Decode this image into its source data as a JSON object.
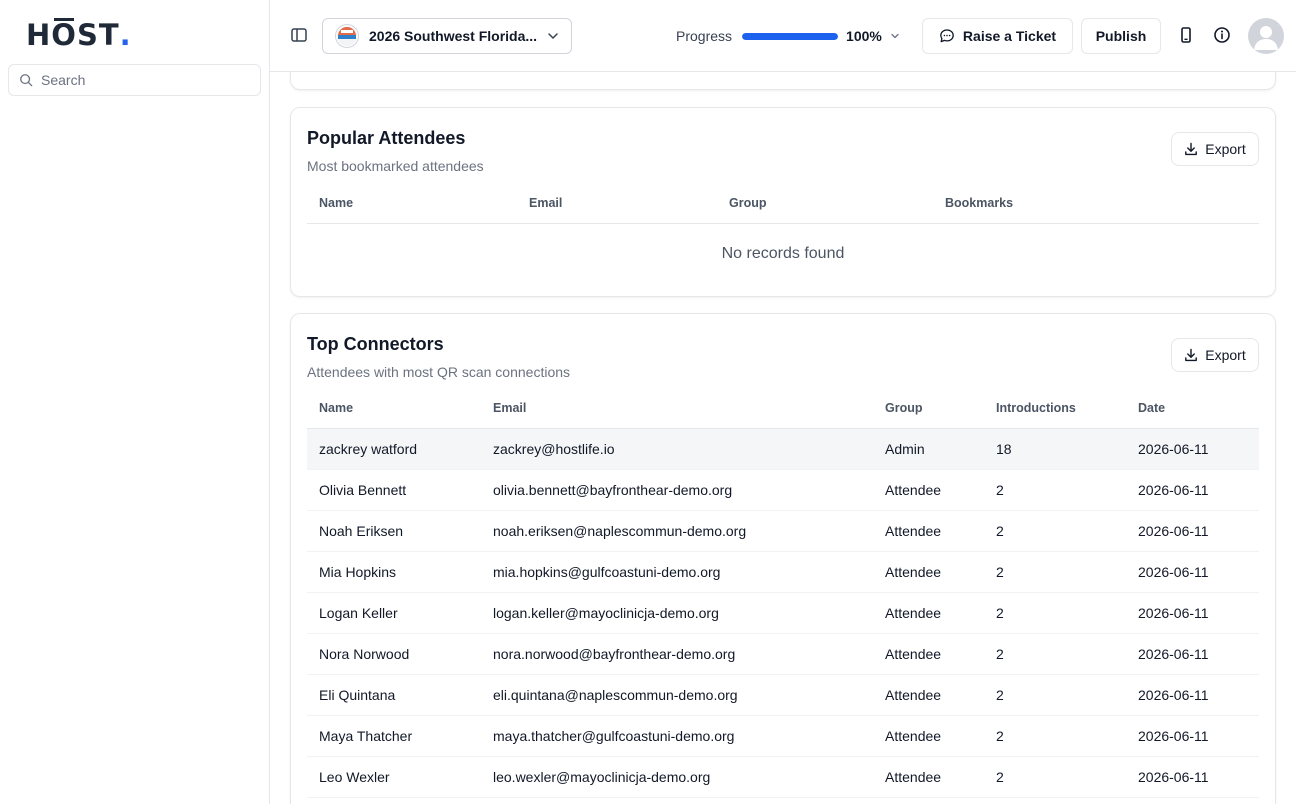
{
  "brand": {
    "letters": [
      "H",
      "O",
      "ST",
      "."
    ],
    "accent": "#2563eb"
  },
  "search": {
    "placeholder": "Search"
  },
  "topbar": {
    "event_name": "2026 Southwest Florida...",
    "progress_label": "Progress",
    "progress_value": "100%",
    "progress_fraction": 1.0,
    "raise_ticket_label": "Raise a Ticket",
    "publish_label": "Publish"
  },
  "popular": {
    "title": "Popular Attendees",
    "subtitle": "Most bookmarked attendees",
    "export_label": "Export",
    "columns": [
      "Name",
      "Email",
      "Group",
      "Bookmarks"
    ],
    "empty_text": "No records found"
  },
  "connectors": {
    "title": "Top Connectors",
    "subtitle": "Attendees with most QR scan connections",
    "export_label": "Export",
    "columns": [
      "Name",
      "Email",
      "Group",
      "Introductions",
      "Date"
    ],
    "rows": [
      {
        "name": "zackrey watford",
        "email": "zackrey@hostlife.io",
        "group": "Admin",
        "introductions": "18",
        "date": "2026-06-11"
      },
      {
        "name": "Olivia Bennett",
        "email": "olivia.bennett@bayfronthear-demo.org",
        "group": "Attendee",
        "introductions": "2",
        "date": "2026-06-11"
      },
      {
        "name": "Noah Eriksen",
        "email": "noah.eriksen@naplescommun-demo.org",
        "group": "Attendee",
        "introductions": "2",
        "date": "2026-06-11"
      },
      {
        "name": "Mia Hopkins",
        "email": "mia.hopkins@gulfcoastuni-demo.org",
        "group": "Attendee",
        "introductions": "2",
        "date": "2026-06-11"
      },
      {
        "name": "Logan Keller",
        "email": "logan.keller@mayoclinicja-demo.org",
        "group": "Attendee",
        "introductions": "2",
        "date": "2026-06-11"
      },
      {
        "name": "Nora Norwood",
        "email": "nora.norwood@bayfronthear-demo.org",
        "group": "Attendee",
        "introductions": "2",
        "date": "2026-06-11"
      },
      {
        "name": "Eli Quintana",
        "email": "eli.quintana@naplescommun-demo.org",
        "group": "Attendee",
        "introductions": "2",
        "date": "2026-06-11"
      },
      {
        "name": "Maya Thatcher",
        "email": "maya.thatcher@gulfcoastuni-demo.org",
        "group": "Attendee",
        "introductions": "2",
        "date": "2026-06-11"
      },
      {
        "name": "Leo Wexler",
        "email": "leo.wexler@mayoclinicja-demo.org",
        "group": "Attendee",
        "introductions": "2",
        "date": "2026-06-11"
      }
    ]
  }
}
